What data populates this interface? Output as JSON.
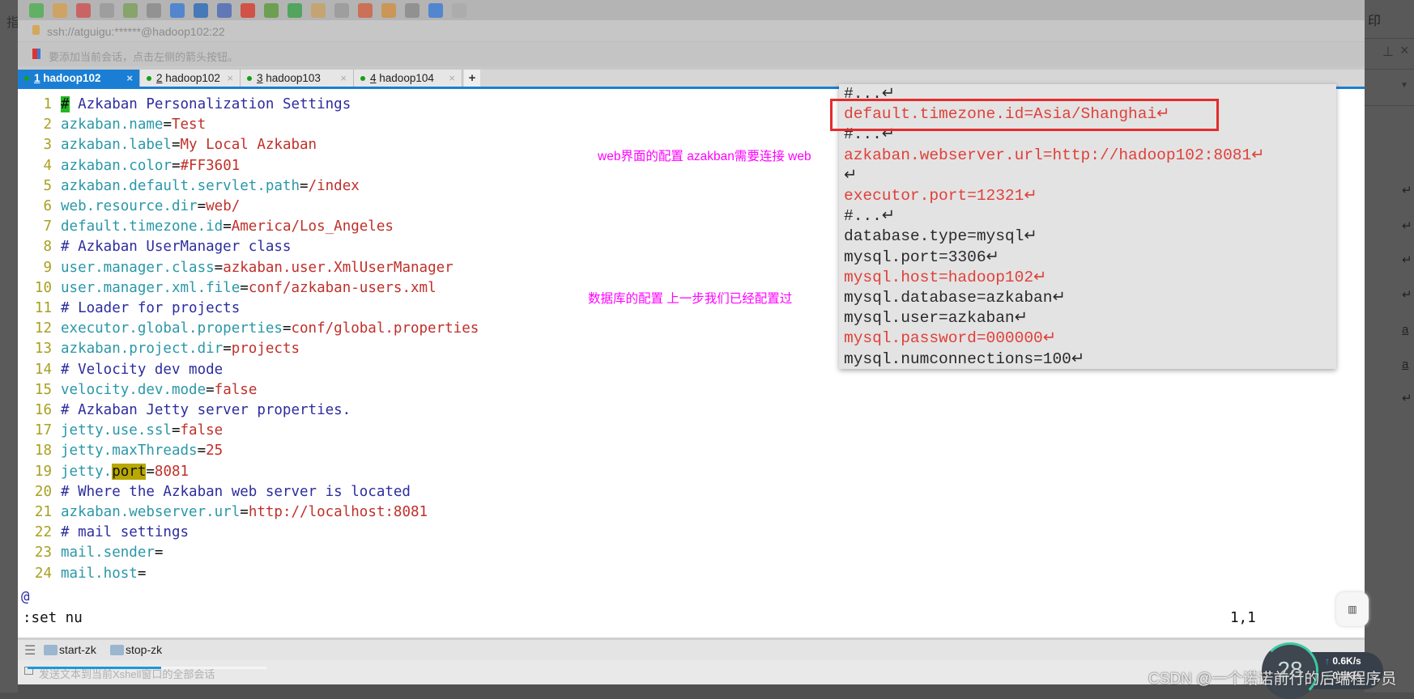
{
  "background_left_char": "指",
  "toolbar": {
    "icons": [
      {
        "name": "new-session-icon",
        "color": "#4caf50"
      },
      {
        "name": "open-folder-icon",
        "color": "#d4a050"
      },
      {
        "name": "connect-icon",
        "color": "#d05050"
      },
      {
        "name": "disconnect-icon",
        "color": "#999999"
      },
      {
        "name": "properties-icon",
        "color": "#7aa05a"
      },
      {
        "name": "find-icon",
        "color": "#8a8a8a"
      },
      {
        "name": "transfer-icon",
        "color": "#3a7bd5"
      },
      {
        "name": "globe-icon",
        "color": "#2a6ab8"
      },
      {
        "name": "font-icon",
        "color": "#4a6ab8"
      },
      {
        "name": "xftp-icon",
        "color": "#d83a2a"
      },
      {
        "name": "xmanager-icon",
        "color": "#5a9a3a"
      },
      {
        "name": "fullscreen-icon",
        "color": "#3aa04a"
      },
      {
        "name": "lock-icon",
        "color": "#c8a060"
      },
      {
        "name": "keyboard-icon",
        "color": "#999999"
      },
      {
        "name": "highlight-icon",
        "color": "#d06040"
      },
      {
        "name": "script-icon",
        "color": "#d09040"
      },
      {
        "name": "layout-icon",
        "color": "#888888"
      },
      {
        "name": "help-icon",
        "color": "#3a7bd5"
      },
      {
        "name": "chat-icon",
        "color": "#aaaaaa"
      }
    ]
  },
  "address": "ssh://atguigu:******@hadoop102:22",
  "session_hint": "要添加当前会话，点击左侧的箭头按钮。",
  "tabs": [
    {
      "num": "1",
      "label": "hadoop102",
      "active": true
    },
    {
      "num": "2",
      "label": "hadoop102",
      "active": false
    },
    {
      "num": "3",
      "label": "hadoop103",
      "active": false
    },
    {
      "num": "4",
      "label": "hadoop104",
      "active": false
    }
  ],
  "tab_add": "+",
  "tab_close": "×",
  "editor": {
    "lines": [
      {
        "n": "1",
        "comment": "# Azkaban Personalization Settings"
      },
      {
        "n": "2",
        "key": "azkaban.name",
        "val": "Test"
      },
      {
        "n": "3",
        "key": "azkaban.label",
        "val": "My Local Azkaban"
      },
      {
        "n": "4",
        "key": "azkaban.color",
        "val": "#FF3601"
      },
      {
        "n": "5",
        "key": "azkaban.default.servlet.path",
        "val": "/index"
      },
      {
        "n": "6",
        "key": "web.resource.dir",
        "val": "web/"
      },
      {
        "n": "7",
        "key": "default.timezone.id",
        "val": "America/Los_Angeles"
      },
      {
        "n": "8",
        "comment": "# Azkaban UserManager class"
      },
      {
        "n": "9",
        "key": "user.manager.class",
        "val": "azkaban.user.XmlUserManager"
      },
      {
        "n": "10",
        "key": "user.manager.xml.file",
        "val": "conf/azkaban-users.xml"
      },
      {
        "n": "11",
        "comment": "# Loader for projects"
      },
      {
        "n": "12",
        "key": "executor.global.properties",
        "val": "conf/global.properties"
      },
      {
        "n": "13",
        "key": "azkaban.project.dir",
        "val": "projects"
      },
      {
        "n": "14",
        "comment": "# Velocity dev mode"
      },
      {
        "n": "15",
        "key": "velocity.dev.mode",
        "val": "false"
      },
      {
        "n": "16",
        "comment": "# Azkaban Jetty server properties."
      },
      {
        "n": "17",
        "key": "jetty.use.ssl",
        "val": "false"
      },
      {
        "n": "18",
        "key": "jetty.maxThreads",
        "val": "25"
      },
      {
        "n": "19",
        "key": "jetty.port",
        "val": "8081",
        "highlight": "port"
      },
      {
        "n": "20",
        "comment": "# Where the Azkaban web server is located"
      },
      {
        "n": "21",
        "key": "azkaban.webserver.url",
        "val": "http://localhost:8081"
      },
      {
        "n": "22",
        "comment": "# mail settings"
      },
      {
        "n": "23",
        "key": "mail.sender",
        "val": ""
      },
      {
        "n": "24",
        "key": "mail.host",
        "val": ""
      }
    ],
    "tilde": "@",
    "command": ":set nu",
    "cursor_pos": "1,1"
  },
  "overlay": {
    "lines": [
      {
        "text": "#...↵",
        "red": false
      },
      {
        "text": "default.timezone.id=Asia/Shanghai↵",
        "red": true
      },
      {
        "text": "#...↵",
        "red": false
      },
      {
        "text": "azkaban.webserver.url=http://hadoop102:8081↵",
        "red": true
      },
      {
        "text": "↵",
        "red": false
      },
      {
        "text": "executor.port=12321↵",
        "red": true
      },
      {
        "text": "#...↵",
        "red": false
      },
      {
        "text": "database.type=mysql↵",
        "red": false
      },
      {
        "text": "mysql.port=3306↵",
        "red": false
      },
      {
        "text": "mysql.host=hadoop102↵",
        "red": true
      },
      {
        "text": "mysql.database=azkaban↵",
        "red": false
      },
      {
        "text": "mysql.user=azkaban↵",
        "red": false
      },
      {
        "text": "mysql.password=000000↵",
        "red": true
      },
      {
        "text": "mysql.numconnections=100↵",
        "red": false
      }
    ]
  },
  "annotations": {
    "web": "web界面的配置 azakban需要连接 web",
    "db": "数据库的配置 上一步我们已经配置过"
  },
  "quick_commands": [
    {
      "label": "start-zk"
    },
    {
      "label": "stop-zk"
    }
  ],
  "status_text": "发送文本到当前Xshell窗口的全部会话",
  "right_panel": {
    "top_char": "印",
    "items": [
      "↵",
      "↵",
      "↵",
      "↵",
      "a",
      "a",
      "↵"
    ]
  },
  "speed_widget": {
    "value": "28",
    "up": "0.6",
    "down": "0.5",
    "unit": "K/s"
  },
  "watermark": "CSDN @一个诺诺前行的后端程序员",
  "colors": {
    "accent": "#1a7fd4",
    "annotation": "#ff00ff",
    "red_box": "#e52b2b",
    "key": "#2a98a8",
    "value": "#c0302a",
    "comment": "#2d2d9f",
    "line_number": "#a8a020"
  }
}
